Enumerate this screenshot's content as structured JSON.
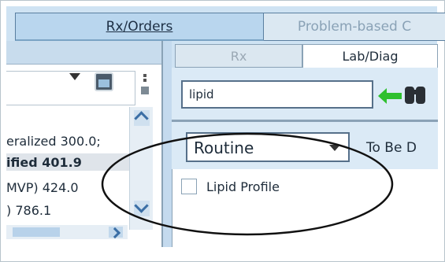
{
  "tabs": {
    "rx_orders": "Rx/Orders",
    "problem_based": "Problem-based C"
  },
  "sub_tabs": {
    "rx": "Rx",
    "lab_diag": "Lab/Diag"
  },
  "search": {
    "value": "lipid"
  },
  "left_list": {
    "rows": [
      "eralized 300.0;",
      "ified 401.9",
      "MVP) 424.0",
      ") 786.1"
    ]
  },
  "priority": {
    "selected": "Routine",
    "to_be_done_label": "To Be D"
  },
  "results": [
    {
      "label": "Lipid Profile",
      "checked": false
    }
  ],
  "colors": {
    "accent_blue": "#cfe3f3",
    "green_arrow": "#2fc02f",
    "annotation_ellipse": "#111111"
  },
  "icons": {
    "dropdown": "chevron-down-icon",
    "calendar": "calendar-icon",
    "go": "green-arrow-icon",
    "search": "binoculars-icon"
  }
}
